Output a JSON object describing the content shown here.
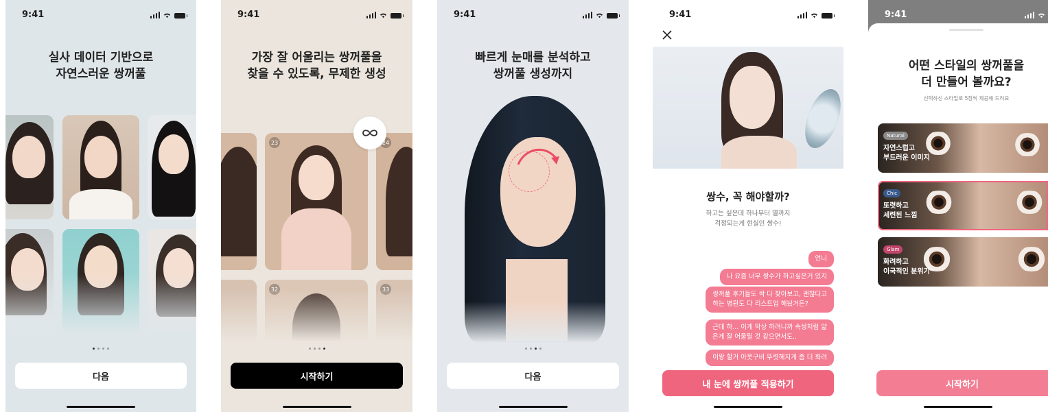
{
  "status": {
    "time": "9:41"
  },
  "screen1": {
    "title_line1": "실사 데이터 기반으로",
    "title_line2": "자연스러운 쌍꺼풀",
    "button": "다음"
  },
  "screen2": {
    "title_line1": "가장 잘 어울리는 쌍꺼풀을",
    "title_line2": "찾을 수 있도록, 무제한 생성",
    "badge_icon": "infinity-icon",
    "card_numbers": [
      "23",
      "24",
      "32",
      "33"
    ],
    "button": "시작하기"
  },
  "screen3": {
    "title_line1": "빠르게 눈매를 분석하고",
    "title_line2": "쌍꺼풀 생성까지",
    "button": "다음"
  },
  "screen4": {
    "close_icon": "close-icon",
    "heading": "쌍수, 꼭 해야할까?",
    "sub_line1": "하고는 싶은데 하나부터 열까지",
    "sub_line2": "걱정되는게 현실인 쌍수!",
    "messages": [
      {
        "lines": [
          "언니"
        ]
      },
      {
        "lines": [
          "나 요즘 너무 쌍수가 하고싶은거 있지"
        ]
      },
      {
        "lines": [
          "쌍꺼풀 후기들도 싹 다 찾아보고, 괜찮다고",
          "하는 병원도 다 리스트업 해놨거든?"
        ]
      },
      {
        "lines": [
          "근데 하... 이게 막상 하려니까 속쌍처럼 얇",
          "은게 잘 어울릴 것 같으면서도.."
        ]
      },
      {
        "lines": [
          "이왕 할거 아웃구비 뚜렷해지게 좀 더 화려"
        ]
      }
    ],
    "button": "내 눈에 쌍꺼풀 적용하기"
  },
  "screen5": {
    "title_line1": "어떤 스타일의 쌍꺼풀을",
    "title_line2": "더 만들어 볼까요?",
    "subtitle": "선택하신 스타일로 5장씩 제공해 드려요",
    "styles": [
      {
        "tag": "Natural",
        "line1": "자연스럽고",
        "line2": "부드러운 이미지",
        "tag_color": "#8a8a8a",
        "selected": false
      },
      {
        "tag": "Chic",
        "line1": "또렷하고",
        "line2": "세련된 느낌",
        "tag_color": "#3a5a8c",
        "selected": true
      },
      {
        "tag": "Glam",
        "line1": "화려하고",
        "line2": "이국적인 분위기",
        "tag_color": "#c2456b",
        "selected": false
      }
    ],
    "button": "시작하기"
  },
  "colors": {
    "accent": "#f0657e",
    "dark": "#000000"
  }
}
